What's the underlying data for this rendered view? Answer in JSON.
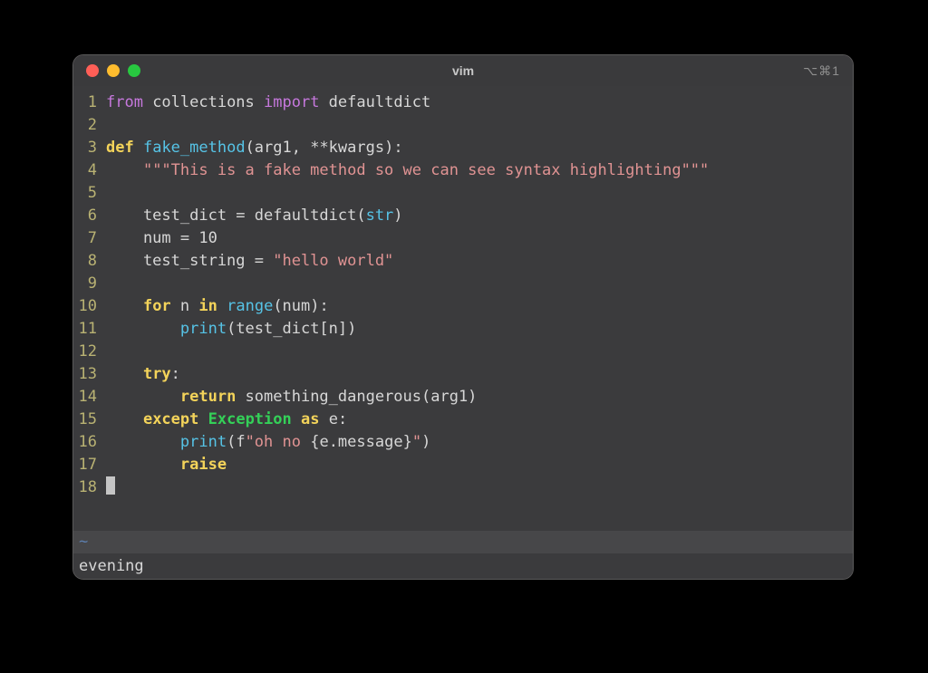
{
  "window": {
    "title": "vim",
    "shortcut": "⌥⌘1",
    "tilde": "~",
    "status": "evening"
  },
  "colors": {
    "keyword": "#f3d35a",
    "import": "#c678dd",
    "function": "#56c3e6",
    "string": "#e09393",
    "exception": "#34d058",
    "linenum": "#b9b273",
    "bg": "#3b3b3d",
    "text": "#d7d7d7"
  },
  "lines": [
    {
      "n": "1",
      "tokens": [
        [
          "imp",
          "from"
        ],
        [
          "code",
          " collections "
        ],
        [
          "imp",
          "import"
        ],
        [
          "code",
          " defaultdict"
        ]
      ]
    },
    {
      "n": "2",
      "tokens": []
    },
    {
      "n": "3",
      "tokens": [
        [
          "kw",
          "def"
        ],
        [
          "code",
          " "
        ],
        [
          "func",
          "fake_method"
        ],
        [
          "code",
          "(arg1, **kwargs):"
        ]
      ]
    },
    {
      "n": "4",
      "tokens": [
        [
          "code",
          "    "
        ],
        [
          "str",
          "\"\"\"This is a fake method so we can see syntax highlighting\"\"\""
        ]
      ]
    },
    {
      "n": "5",
      "tokens": []
    },
    {
      "n": "6",
      "tokens": [
        [
          "code",
          "    test_dict = defaultdict("
        ],
        [
          "ident",
          "str"
        ],
        [
          "code",
          ")"
        ]
      ]
    },
    {
      "n": "7",
      "tokens": [
        [
          "code",
          "    num = 10"
        ]
      ]
    },
    {
      "n": "8",
      "tokens": [
        [
          "code",
          "    test_string = "
        ],
        [
          "str",
          "\"hello world\""
        ]
      ]
    },
    {
      "n": "9",
      "tokens": []
    },
    {
      "n": "10",
      "tokens": [
        [
          "code",
          "    "
        ],
        [
          "kw",
          "for"
        ],
        [
          "code",
          " n "
        ],
        [
          "kw",
          "in"
        ],
        [
          "code",
          " "
        ],
        [
          "builtin",
          "range"
        ],
        [
          "code",
          "(num):"
        ]
      ]
    },
    {
      "n": "11",
      "tokens": [
        [
          "code",
          "        "
        ],
        [
          "builtin",
          "print"
        ],
        [
          "code",
          "(test_dict[n])"
        ]
      ]
    },
    {
      "n": "12",
      "tokens": []
    },
    {
      "n": "13",
      "tokens": [
        [
          "code",
          "    "
        ],
        [
          "kw",
          "try"
        ],
        [
          "code",
          ":"
        ]
      ]
    },
    {
      "n": "14",
      "tokens": [
        [
          "code",
          "        "
        ],
        [
          "kw",
          "return"
        ],
        [
          "code",
          " something_dangerous(arg1)"
        ]
      ]
    },
    {
      "n": "15",
      "tokens": [
        [
          "code",
          "    "
        ],
        [
          "kw",
          "except"
        ],
        [
          "code",
          " "
        ],
        [
          "exc",
          "Exception"
        ],
        [
          "code",
          " "
        ],
        [
          "kw",
          "as"
        ],
        [
          "code",
          " e:"
        ]
      ]
    },
    {
      "n": "16",
      "tokens": [
        [
          "code",
          "        "
        ],
        [
          "builtin",
          "print"
        ],
        [
          "code",
          "(f"
        ],
        [
          "str",
          "\"oh no "
        ],
        [
          "code",
          "{e.message}"
        ],
        [
          "str",
          "\""
        ],
        [
          "code",
          ")"
        ]
      ]
    },
    {
      "n": "17",
      "tokens": [
        [
          "code",
          "        "
        ],
        [
          "kw",
          "raise"
        ]
      ]
    },
    {
      "n": "18",
      "tokens": [
        [
          "cursor",
          ""
        ]
      ]
    }
  ]
}
